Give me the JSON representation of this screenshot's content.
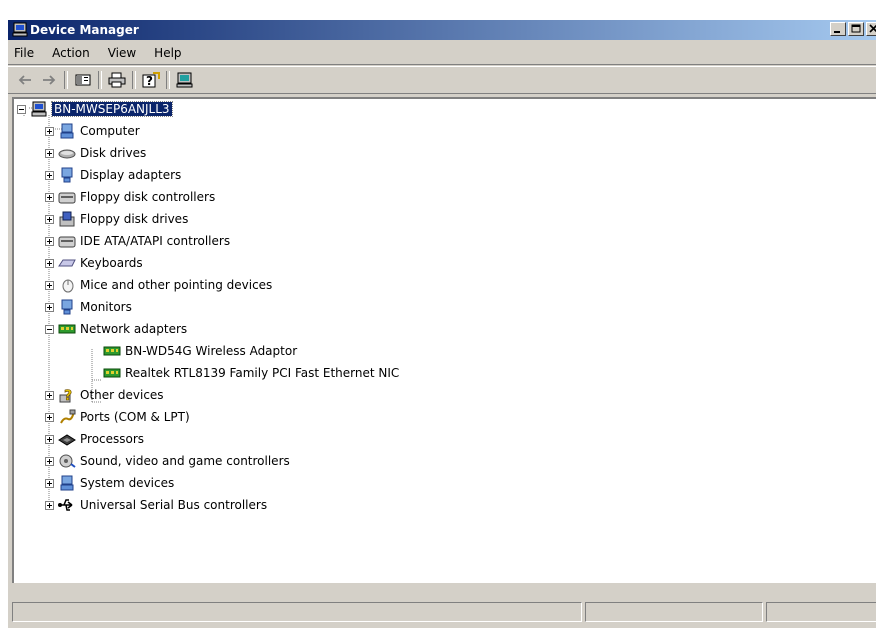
{
  "window": {
    "title": "Device Manager",
    "icon": "computer-icon",
    "controls": [
      "minimize",
      "maximize",
      "close"
    ]
  },
  "menu": {
    "items": [
      {
        "label": "File"
      },
      {
        "label": "Action"
      },
      {
        "label": "View"
      },
      {
        "label": "Help"
      }
    ]
  },
  "toolbar": {
    "buttons": [
      "back-arrow-icon",
      "forward-arrow-icon",
      "show-hide-tree-icon",
      "print-icon",
      "help-icon",
      "scan-hardware-icon"
    ]
  },
  "tree": {
    "root": {
      "label": "BN-MWSEP6ANJLL3",
      "icon": "computer-icon",
      "expanded": true,
      "selected": true
    },
    "categories": [
      {
        "label": "Computer",
        "icon": "computer-icon"
      },
      {
        "label": "Disk drives",
        "icon": "disk-drive-icon"
      },
      {
        "label": "Display adapters",
        "icon": "display-adapter-icon"
      },
      {
        "label": "Floppy disk controllers",
        "icon": "floppy-controller-icon"
      },
      {
        "label": "Floppy disk drives",
        "icon": "floppy-drive-icon"
      },
      {
        "label": "IDE ATA/ATAPI controllers",
        "icon": "ide-controller-icon"
      },
      {
        "label": "Keyboards",
        "icon": "keyboard-icon"
      },
      {
        "label": "Mice and other pointing devices",
        "icon": "mouse-icon"
      },
      {
        "label": "Monitors",
        "icon": "monitor-icon"
      },
      {
        "label": "Network adapters",
        "icon": "network-adapter-icon",
        "expanded": true
      },
      {
        "label": "Other devices",
        "icon": "unknown-device-icon"
      },
      {
        "label": "Ports (COM & LPT)",
        "icon": "port-icon"
      },
      {
        "label": "Processors",
        "icon": "processor-icon"
      },
      {
        "label": "Sound, video and game controllers",
        "icon": "sound-icon"
      },
      {
        "label": "System devices",
        "icon": "system-device-icon"
      },
      {
        "label": "Universal Serial Bus controllers",
        "icon": "usb-icon"
      }
    ],
    "network_children": [
      {
        "label": "BN-WD54G Wireless Adaptor",
        "icon": "network-adapter-icon"
      },
      {
        "label": "Realtek RTL8139 Family PCI Fast Ethernet NIC",
        "icon": "network-adapter-icon"
      }
    ]
  },
  "statusbar": {
    "panes": [
      "",
      "",
      ""
    ]
  }
}
